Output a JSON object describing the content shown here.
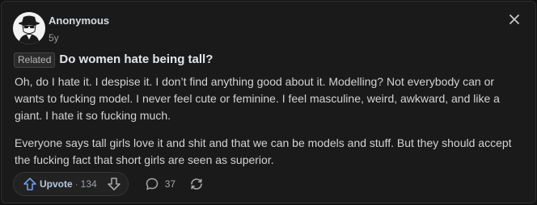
{
  "post": {
    "author": "Anonymous",
    "age": "5y",
    "tag": "Related",
    "title": "Do women hate being tall?",
    "paragraphs": [
      "Oh, do I hate it. I despise it. I don’t find anything good about it. Modelling? Not everybody can or wants to fucking model. I never feel cute or feminine. I feel masculine, weird, awkward, and like a giant. I hate it so fucking much.",
      "Everyone says tall girls love it and shit and that we can be models and stuff. But they should accept the fucking fact that short girls are seen as superior."
    ]
  },
  "actions": {
    "upvote_label": "Upvote",
    "separator": "·",
    "upvote_count": "134",
    "comments_count": "37"
  },
  "icons": {
    "avatar": "anonymous-avatar-icon",
    "close": "close-icon",
    "upvote": "upvote-arrow-icon",
    "downvote": "downvote-arrow-icon",
    "comments": "comment-bubble-icon",
    "share": "share-icon"
  },
  "colors": {
    "background": "#1a1a1b",
    "upvote_accent": "#6f9be8",
    "text": "#d3d3d3"
  }
}
